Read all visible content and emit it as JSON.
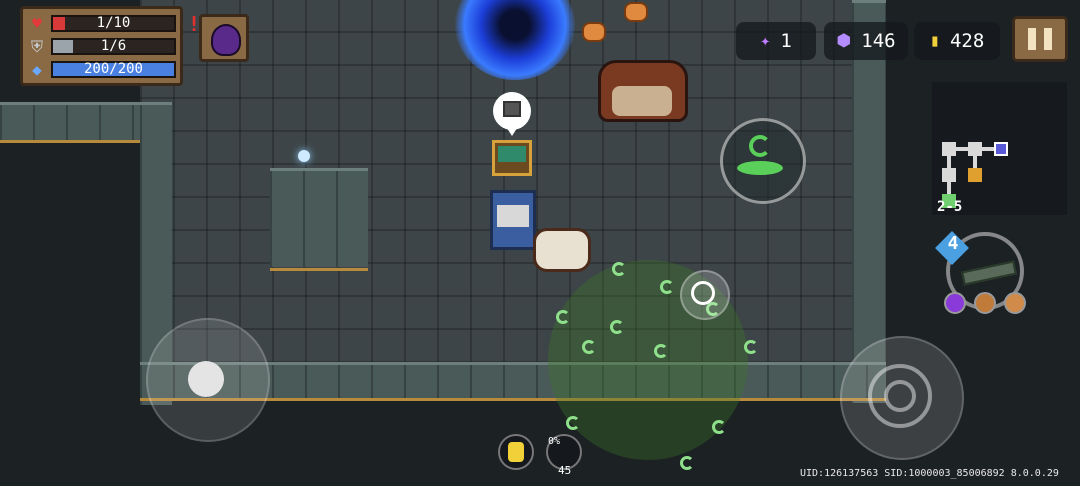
{
  "hud": {
    "health": {
      "current": 1,
      "max": 10,
      "text": "1/10",
      "color": "#d83a3a"
    },
    "armor": {
      "current": 1,
      "max": 6,
      "text": "1/6",
      "color": "#9aa4aa"
    },
    "energy": {
      "current": 200,
      "max": 200,
      "text": "200/200",
      "color": "#4a80e0"
    },
    "alert_mark": "!"
  },
  "currency": {
    "shards": "1",
    "gems": "146",
    "gold": "428"
  },
  "minimap": {
    "level": "2-5"
  },
  "weapon": {
    "energy_cost": "4"
  },
  "skill_slot": {
    "percent": "0%",
    "count": "45"
  },
  "footer": {
    "uid_text": "UID:126137563 SID:1000003_85006892 8.0.0.29"
  },
  "colors": {
    "health": "#d83a3a",
    "armor": "#9aa4aa",
    "energy": "#4a80e0",
    "gold": "#f2d03a",
    "gem": "#b48cff"
  }
}
